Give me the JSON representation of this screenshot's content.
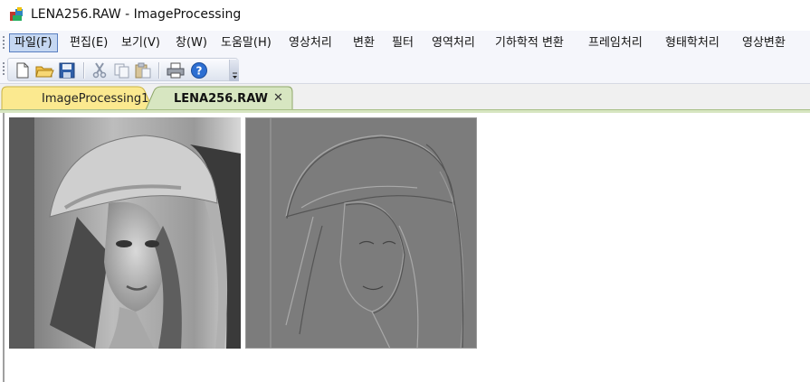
{
  "window": {
    "title": "LENA256.RAW - ImageProcessing",
    "icon": "app-icon"
  },
  "menu": {
    "items": [
      {
        "label": "파일(F)",
        "active": true
      },
      {
        "label": "편집(E)"
      },
      {
        "label": "보기(V)"
      },
      {
        "label": "창(W)"
      },
      {
        "label": "도움말(H)"
      },
      {
        "label": "영상처리"
      },
      {
        "label": "변환"
      },
      {
        "label": "필터"
      },
      {
        "label": "영역처리"
      },
      {
        "label": "기하학적 변환"
      },
      {
        "label": "프레임처리"
      },
      {
        "label": "형태학처리"
      },
      {
        "label": "영상변환"
      }
    ]
  },
  "toolbar": {
    "buttons": [
      "new-file-icon",
      "open-folder-icon",
      "save-icon",
      "cut-icon",
      "copy-icon",
      "paste-icon",
      "print-icon",
      "help-icon"
    ]
  },
  "tabs": [
    {
      "label": "ImageProcessing1",
      "active": false
    },
    {
      "label": "LENA256.RAW",
      "active": true,
      "close": "✕"
    }
  ],
  "images": [
    {
      "name": "original-image",
      "description_icon": "grayscale-photo"
    },
    {
      "name": "processed-image",
      "description_icon": "emboss-filtered-photo"
    }
  ],
  "colors": {
    "menu_active_bg": "#c5d7f2",
    "inactive_tab": "#fbe98f",
    "active_tab": "#d7e6c1",
    "emboss_gray": "#7c7c7c"
  }
}
